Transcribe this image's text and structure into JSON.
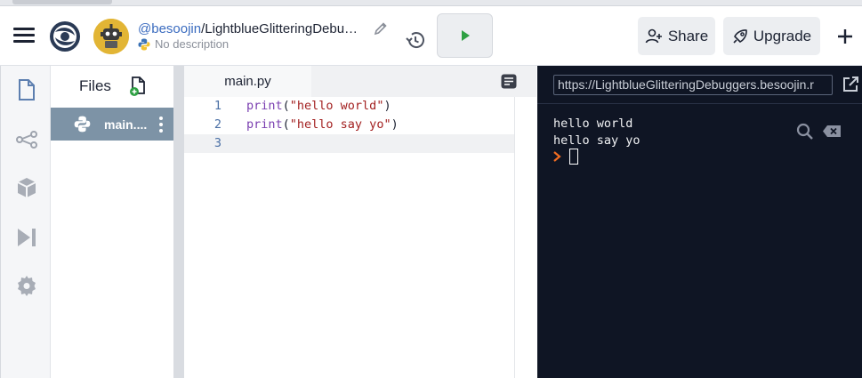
{
  "header": {
    "user": "@besoojin",
    "separator": "/",
    "repl_name": "LightblueGlitteringDebu…",
    "description": "No description",
    "share_label": "Share",
    "upgrade_label": "Upgrade"
  },
  "files_panel": {
    "title": "Files",
    "items": [
      {
        "name": "main...."
      }
    ]
  },
  "editor": {
    "tab_label": "main.py",
    "lines": [
      {
        "num": "1",
        "fn": "print",
        "open": "(",
        "str": "\"hello world\"",
        "close": ")"
      },
      {
        "num": "2",
        "fn": "print",
        "open": "(",
        "str": "\"hello say yo\"",
        "close": ")"
      },
      {
        "num": "3",
        "fn": "",
        "open": "",
        "str": "",
        "close": ""
      }
    ]
  },
  "console": {
    "url": "https://LightblueGlitteringDebuggers.besoojin.r",
    "output": [
      "hello world",
      "hello say yo"
    ]
  },
  "colors": {
    "accent": "#3a6bbf",
    "run_green": "#2ea043",
    "console_bg": "#0f1524",
    "prompt_orange": "#f26d21",
    "selected_file": "#7d93a6"
  },
  "icons": {
    "menu": "hamburger-icon",
    "logo": "replit-logo",
    "edit": "pencil-icon",
    "history": "history-icon",
    "run": "play-icon",
    "share": "person-add-icon",
    "upgrade": "rocket-icon",
    "add": "plus-icon"
  }
}
